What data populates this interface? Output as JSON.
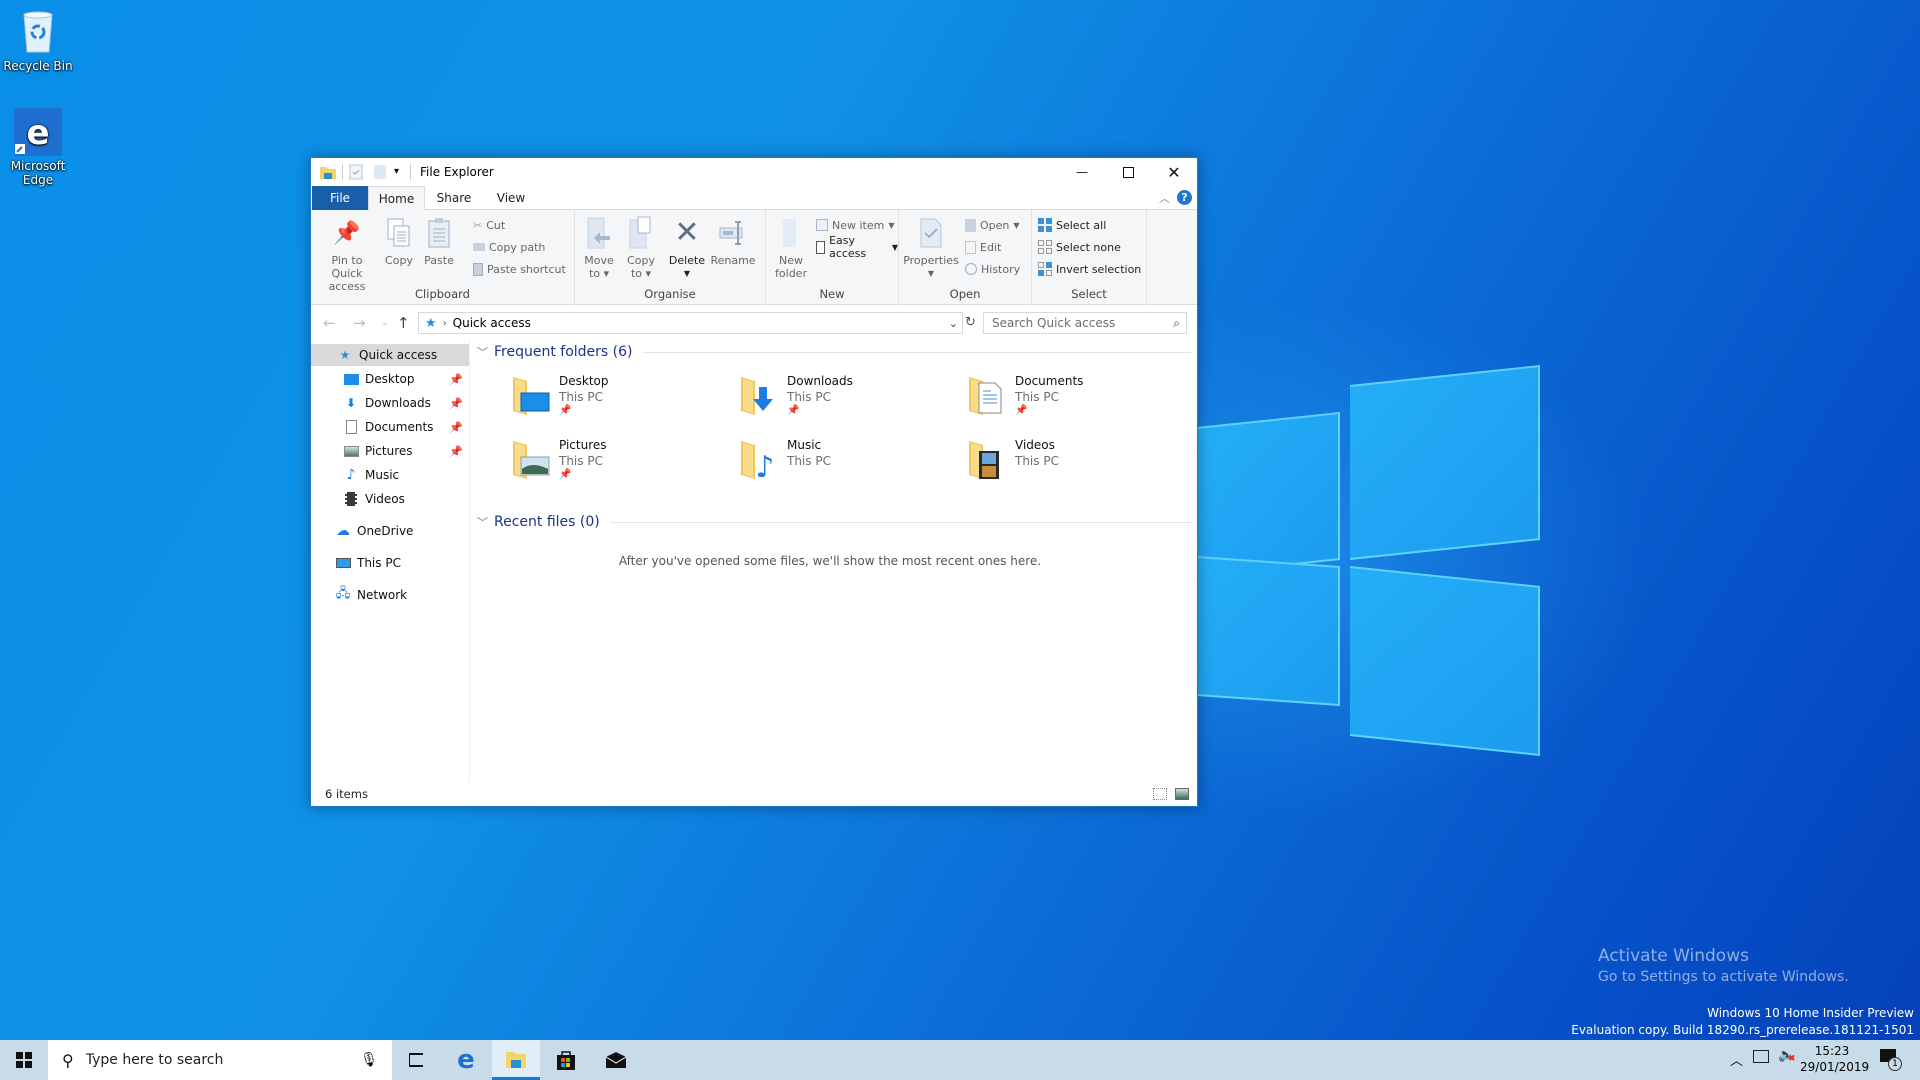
{
  "desktop": {
    "icons": [
      {
        "label": "Recycle Bin",
        "icon": "recycle-bin-icon"
      },
      {
        "label": "Microsoft Edge",
        "icon": "edge-icon"
      }
    ],
    "watermark": {
      "activate_title": "Activate Windows",
      "activate_sub": "Go to Settings to activate Windows.",
      "edition": "Windows 10 Home Insider Preview",
      "build": "Evaluation copy. Build 18290.rs_prerelease.181121-1501"
    }
  },
  "window": {
    "title": "File Explorer",
    "controls": {
      "minimize": "—",
      "maximize": "☐",
      "close": "✕"
    },
    "tabs": [
      {
        "label": "File"
      },
      {
        "label": "Home",
        "active": true
      },
      {
        "label": "Share"
      },
      {
        "label": "View"
      }
    ],
    "ribbon": {
      "clipboard": {
        "label": "Clipboard",
        "pin": "Pin to Quick access",
        "pin_l1": "Pin to Quick",
        "pin_l2": "access",
        "copy": "Copy",
        "paste": "Paste",
        "cut": "Cut",
        "copy_path": "Copy path",
        "paste_shortcut": "Paste shortcut"
      },
      "organise": {
        "label": "Organise",
        "move_l1": "Move",
        "move_l2": "to",
        "copy_l1": "Copy",
        "copy_l2": "to",
        "delete": "Delete",
        "rename": "Rename"
      },
      "new": {
        "label": "New",
        "folder_l1": "New",
        "folder_l2": "folder",
        "new_item": "New item",
        "easy_access": "Easy access"
      },
      "open": {
        "label": "Open",
        "properties": "Properties",
        "open": "Open",
        "edit": "Edit",
        "history": "History"
      },
      "select": {
        "label": "Select",
        "select_all": "Select all",
        "select_none": "Select none",
        "invert": "Invert selection"
      }
    },
    "address": {
      "path": "Quick access",
      "search_placeholder": "Search Quick access"
    },
    "sidebar": {
      "items": [
        {
          "label": "Quick access",
          "icon": "star-icon",
          "selected": true
        },
        {
          "label": "Desktop",
          "icon": "desktop-icon",
          "pinned": true
        },
        {
          "label": "Downloads",
          "icon": "download-icon",
          "pinned": true
        },
        {
          "label": "Documents",
          "icon": "document-icon",
          "pinned": true
        },
        {
          "label": "Pictures",
          "icon": "picture-icon",
          "pinned": true
        },
        {
          "label": "Music",
          "icon": "music-icon"
        },
        {
          "label": "Videos",
          "icon": "video-icon"
        },
        {
          "label": "OneDrive",
          "icon": "cloud-icon"
        },
        {
          "label": "This PC",
          "icon": "computer-icon"
        },
        {
          "label": "Network",
          "icon": "network-icon"
        }
      ]
    },
    "content": {
      "frequent_header": "Frequent folders (6)",
      "recent_header": "Recent files (0)",
      "recent_empty": "After you've opened some files, we'll show the most recent ones here.",
      "folders": [
        {
          "name": "Desktop",
          "location": "This PC",
          "pinned": true
        },
        {
          "name": "Downloads",
          "location": "This PC",
          "pinned": true
        },
        {
          "name": "Documents",
          "location": "This PC",
          "pinned": true
        },
        {
          "name": "Pictures",
          "location": "This PC",
          "pinned": true
        },
        {
          "name": "Music",
          "location": "This PC",
          "pinned": false
        },
        {
          "name": "Videos",
          "location": "This PC",
          "pinned": false
        }
      ]
    },
    "status": {
      "items_count": "6 items"
    }
  },
  "taskbar": {
    "search_placeholder": "Type here to search",
    "apps": [
      "task-view",
      "edge",
      "file-explorer",
      "store",
      "mail"
    ],
    "active_app": "file-explorer",
    "time": "15:23",
    "date": "29/01/2019",
    "notifications": "1"
  },
  "colors": {
    "accent": "#195ea8",
    "section_header": "#1e3287",
    "folder_yellow": "#f5d36b"
  }
}
